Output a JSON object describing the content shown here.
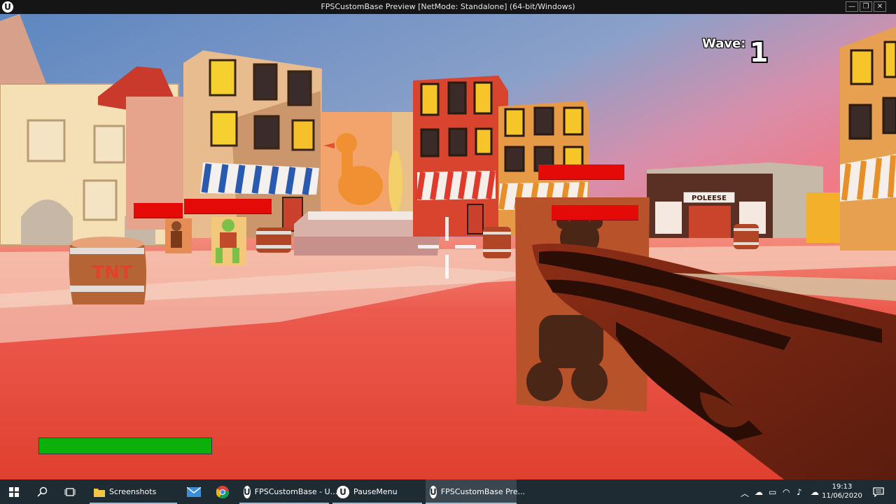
{
  "window": {
    "title": "FPSCustomBase Preview [NetMode: Standalone]  (64-bit/Windows)",
    "logo_glyph": "U",
    "minimize_glyph": "—",
    "maximize_glyph": "❐",
    "close_glyph": "✕"
  },
  "hud": {
    "wave_label": "Wave:",
    "wave_number": "1",
    "player_health_fraction": 1.0,
    "health_color": "#0bb00b",
    "enemy_bar_color": "#e40a08"
  },
  "scene": {
    "shop_sign": "POLEESE",
    "barrel_label": "TNT"
  },
  "taskbar": {
    "start_icon": "windows-start-icon",
    "search_icon": "search-icon",
    "taskview_icon": "task-view-icon",
    "apps": [
      {
        "label": "Screenshots",
        "icon": "folder-icon"
      },
      {
        "label": "",
        "icon": "mail-icon"
      },
      {
        "label": "",
        "icon": "chrome-icon"
      },
      {
        "label": "FPSCustomBase - U...",
        "icon": "unreal-icon"
      },
      {
        "label": "PauseMenu",
        "icon": "unreal-icon"
      },
      {
        "label": "FPSCustomBase Pre...",
        "icon": "unreal-icon"
      }
    ],
    "time": "19:13",
    "date": "11/06/2020"
  }
}
